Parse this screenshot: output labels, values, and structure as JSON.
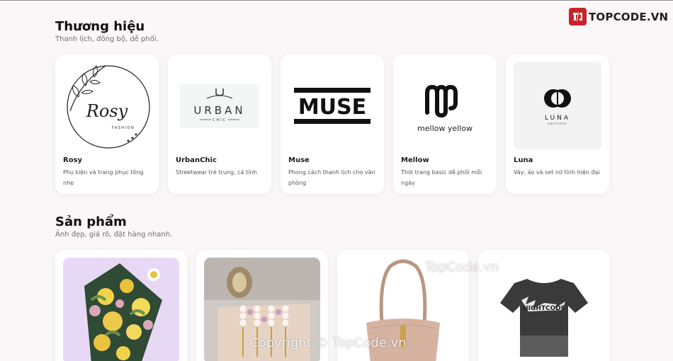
{
  "watermark": {
    "logo_text": "TOPCODE.VN",
    "center_text": "TopCode.vn",
    "copyright_text": "Copyright © TopCode.vn"
  },
  "brands_section": {
    "title": "Thương hiệu",
    "subtitle": "Thanh lịch, đồng bộ, dễ phối.",
    "items": [
      {
        "name": "Rosy",
        "description": "Phụ kiện và trang phục tông nhẹ",
        "logo_text": "Rosy",
        "logo_subtext": "FASHION"
      },
      {
        "name": "UrbanChic",
        "description": "Streetwear trẻ trung, cá tính",
        "logo_text": "URBAN",
        "logo_subtext": "CHIC"
      },
      {
        "name": "Muse",
        "description": "Phong cách thanh lịch cho văn phòng",
        "logo_text": "MUSE"
      },
      {
        "name": "Mellow",
        "description": "Thời trang basic dễ phối mỗi ngày",
        "logo_text": "mellow yellow"
      },
      {
        "name": "Luna",
        "description": "Váy, áo và set nữ tính hiện đại",
        "logo_text": "LUNA",
        "logo_subtext": "BROTHERS"
      }
    ]
  },
  "products_section": {
    "title": "Sản phẩm",
    "subtitle": "Ảnh đẹp, giá rõ, đặt hàng nhanh.",
    "items": [
      {
        "image": "floral-silk-scarf"
      },
      {
        "image": "pearl-hairpins"
      },
      {
        "image": "beige-leather-shoulder-bag"
      },
      {
        "image": "black-graphic-tshirt",
        "print_text": "NIGHTCODE"
      }
    ]
  },
  "colors": {
    "background": "#fbf6f7",
    "card": "#ffffff",
    "watermark_red": "#c8232c"
  }
}
